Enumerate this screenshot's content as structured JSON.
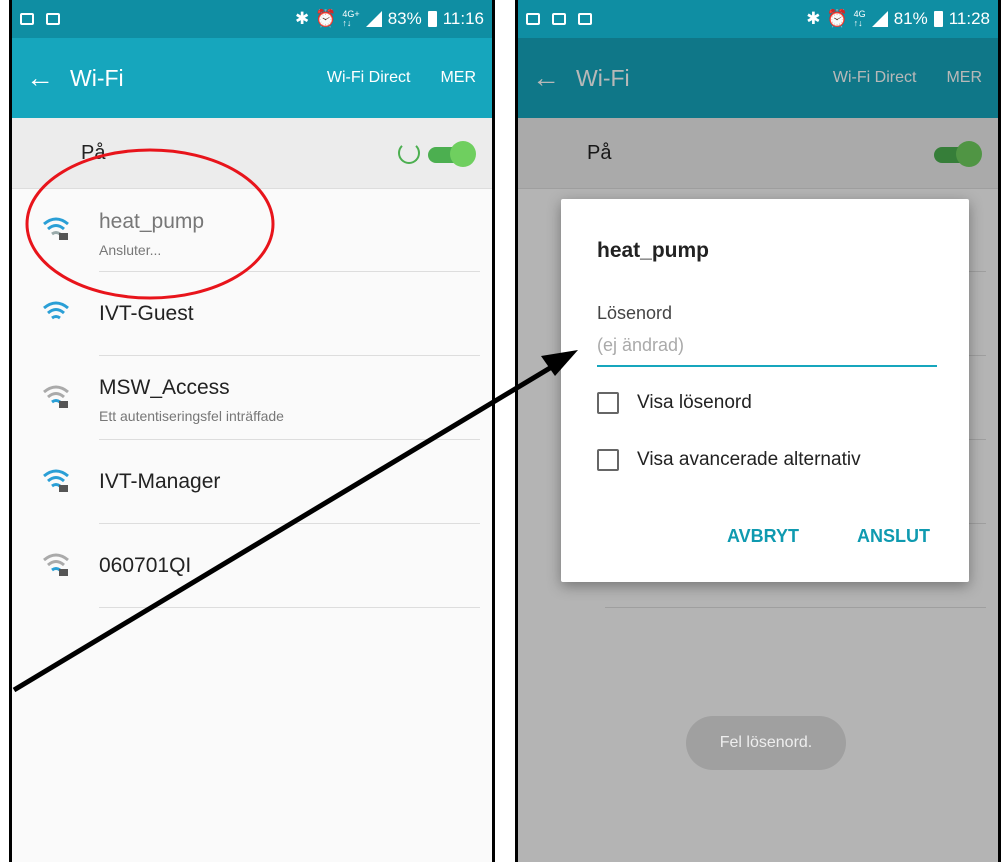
{
  "left": {
    "status": {
      "time": "11:16",
      "battery": "83%",
      "network_top": "4G+",
      "network_bottom": "↑↓"
    },
    "appbar": {
      "title": "Wi-Fi",
      "wifi_direct": "Wi-Fi Direct",
      "more": "MER"
    },
    "wifi_toggle": {
      "label": "På",
      "state": "on",
      "scanning": true
    },
    "networks": [
      {
        "name": "heat_pump",
        "status": "Ansluter...",
        "secured": true,
        "signal": "medium"
      },
      {
        "name": "IVT-Guest",
        "status": "",
        "secured": false,
        "signal": "full"
      },
      {
        "name": "MSW_Access",
        "status": "Ett autentiseringsfel inträffade",
        "secured": true,
        "signal": "medium"
      },
      {
        "name": "IVT-Manager",
        "status": "",
        "secured": true,
        "signal": "full"
      },
      {
        "name": "060701QI",
        "status": "",
        "secured": true,
        "signal": "low"
      }
    ]
  },
  "right": {
    "status": {
      "time": "11:28",
      "battery": "81%",
      "network_top": "4G",
      "network_bottom": "↑↓"
    },
    "appbar": {
      "title": "Wi-Fi",
      "wifi_direct": "Wi-Fi Direct",
      "more": "MER"
    },
    "wifi_toggle": {
      "label": "På",
      "state": "on"
    },
    "dialog": {
      "title": "heat_pump",
      "password_label": "Lösenord",
      "password_placeholder": "(ej ändrad)",
      "show_password": "Visa lösenord",
      "show_advanced": "Visa avancerade alternativ",
      "cancel": "AVBRYT",
      "connect": "ANSLUT"
    },
    "toast": "Fel lösenord."
  },
  "colors": {
    "statusbar": "#0f8ea3",
    "appbar": "#16a6bd",
    "toggle_on": "#4caf50",
    "annotation_circle": "#e8141b",
    "arrow": "#000000"
  }
}
